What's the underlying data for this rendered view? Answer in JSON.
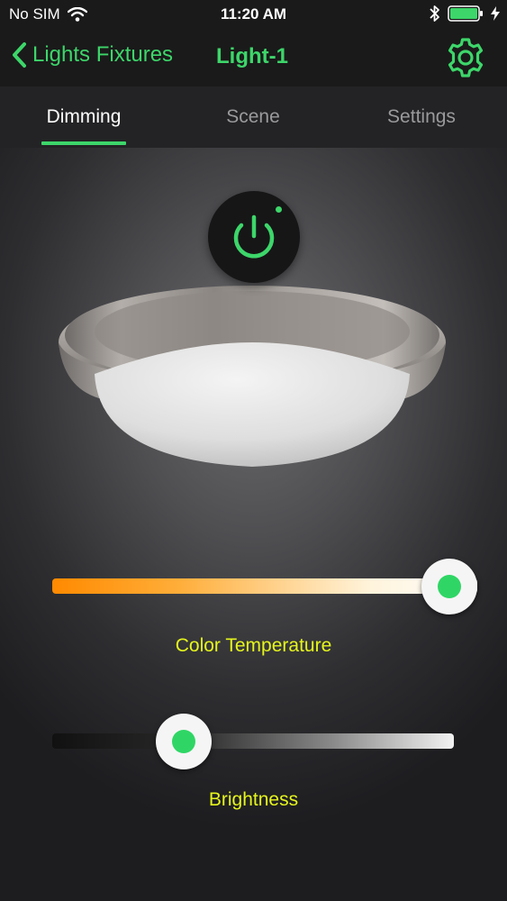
{
  "status_bar": {
    "carrier": "No SIM",
    "time": "11:20 AM"
  },
  "nav": {
    "back_label": "Lights Fixtures",
    "title": "Light-1"
  },
  "tabs": [
    {
      "label": "Dimming",
      "active": true
    },
    {
      "label": "Scene",
      "active": false
    },
    {
      "label": "Settings",
      "active": false
    }
  ],
  "controls": {
    "color_temperature": {
      "label": "Color Temperature",
      "value_fraction": 1.0
    },
    "brightness": {
      "label": "Brightness",
      "value_fraction": 0.3
    }
  },
  "colors": {
    "accent": "#3dd66a",
    "label": "#e5f51c",
    "warm": "#ff8a00"
  },
  "icons": {
    "wifi": "wifi-icon",
    "bluetooth": "bluetooth-icon",
    "battery": "battery-icon",
    "charging": "bolt-icon",
    "back": "chevron-left-icon",
    "settings": "gear-icon",
    "power": "power-icon"
  }
}
